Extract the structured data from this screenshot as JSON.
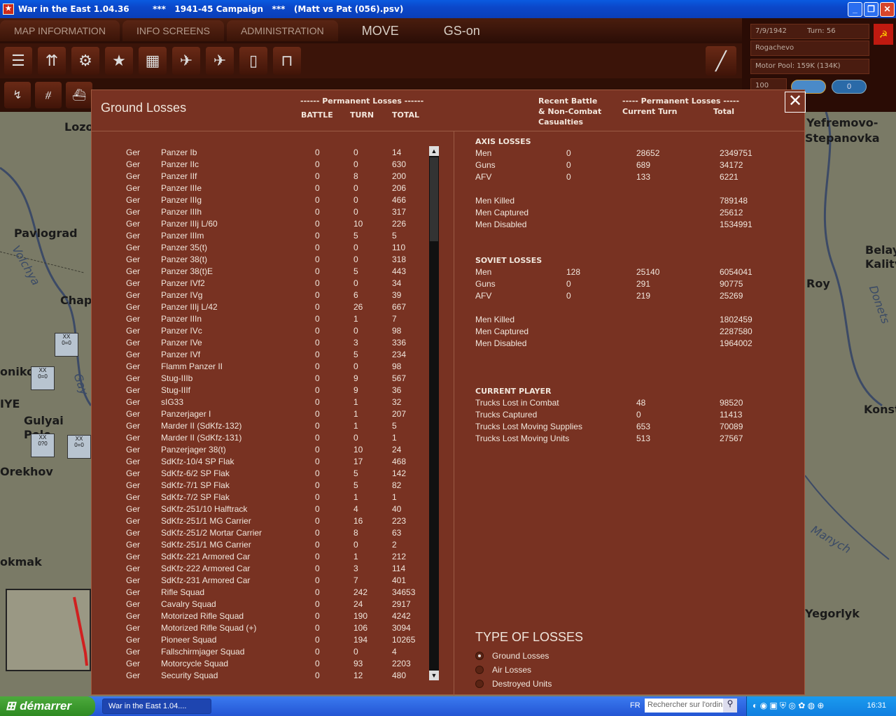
{
  "window": {
    "title": "War in the East 1.04.36        ***   1941-45 Campaign   ***   (Matt vs Pat (056).psv)",
    "buttons": [
      "_",
      "❐",
      "✕"
    ]
  },
  "menu": {
    "tabs": [
      "MAP INFORMATION",
      "INFO SCREENS",
      "ADMINISTRATION"
    ],
    "move": "MOVE",
    "gs": "GS-on"
  },
  "info": {
    "date": "7/9/1942",
    "turn": "Turn: 56",
    "location": "Rogachevo",
    "motor_pool": "Motor Pool: 159K (134K)",
    "zoom": "100",
    "counter": "0"
  },
  "map_labels": {
    "lozo": "Lozo",
    "pavlograd": "Pavlograd",
    "volchya": "Volchya",
    "chap": "Chap",
    "onikolo": "onikolo",
    "iye": "IYE",
    "gulyai": "Gulyai",
    "pole": "Pole",
    "orekhov": "Orekhov",
    "tokmak": "okmak",
    "gay": "Gay",
    "yefremovo": "Yefremovo-",
    "stepanovka": "Stepanovka",
    "belay": "Belay",
    "kalitv": "Kalitv",
    "roy": "Roy",
    "donets": "Donets",
    "konst": "Konst",
    "manych": "Manych",
    "yegorlyk": "Yegorlyk"
  },
  "dialog": {
    "title": "Ground Losses",
    "left_header": {
      "group": "------ Permanent Losses ------",
      "battle": "BATTLE",
      "turn": "TURN",
      "total": "TOTAL"
    },
    "right_header": {
      "recent": "Recent Battle\n& Non-Combat\nCasualties",
      "perm": "----- Permanent Losses -----",
      "current_turn": "Current Turn",
      "total": "Total"
    },
    "rows": [
      [
        "Ger",
        "Panzer Ib",
        "0",
        "0",
        "14"
      ],
      [
        "Ger",
        "Panzer IIc",
        "0",
        "0",
        "630"
      ],
      [
        "Ger",
        "Panzer IIf",
        "0",
        "8",
        "200"
      ],
      [
        "Ger",
        "Panzer IIIe",
        "0",
        "0",
        "206"
      ],
      [
        "Ger",
        "Panzer IIIg",
        "0",
        "0",
        "466"
      ],
      [
        "Ger",
        "Panzer IIIh",
        "0",
        "0",
        "317"
      ],
      [
        "Ger",
        "Panzer IIIj L/60",
        "0",
        "10",
        "226"
      ],
      [
        "Ger",
        "Panzer IIIm",
        "0",
        "5",
        "5"
      ],
      [
        "Ger",
        "Panzer 35(t)",
        "0",
        "0",
        "110"
      ],
      [
        "Ger",
        "Panzer 38(t)",
        "0",
        "0",
        "318"
      ],
      [
        "Ger",
        "Panzer 38(t)E",
        "0",
        "5",
        "443"
      ],
      [
        "Ger",
        "Panzer IVf2",
        "0",
        "0",
        "34"
      ],
      [
        "Ger",
        "Panzer IVg",
        "0",
        "6",
        "39"
      ],
      [
        "Ger",
        "Panzer IIIj L/42",
        "0",
        "26",
        "667"
      ],
      [
        "Ger",
        "Panzer IIIn",
        "0",
        "1",
        "7"
      ],
      [
        "Ger",
        "Panzer IVc",
        "0",
        "0",
        "98"
      ],
      [
        "Ger",
        "Panzer IVe",
        "0",
        "3",
        "336"
      ],
      [
        "Ger",
        "Panzer IVf",
        "0",
        "5",
        "234"
      ],
      [
        "Ger",
        "Flamm Panzer II",
        "0",
        "0",
        "98"
      ],
      [
        "Ger",
        "Stug-IIIb",
        "0",
        "9",
        "567"
      ],
      [
        "Ger",
        "Stug-IIIf",
        "0",
        "9",
        "36"
      ],
      [
        "Ger",
        "sIG33",
        "0",
        "1",
        "32"
      ],
      [
        "Ger",
        "Panzerjager I",
        "0",
        "1",
        "207"
      ],
      [
        "Ger",
        "Marder II (SdKfz-132)",
        "0",
        "1",
        "5"
      ],
      [
        "Ger",
        "Marder II (SdKfz-131)",
        "0",
        "0",
        "1"
      ],
      [
        "Ger",
        "Panzerjager 38(t)",
        "0",
        "10",
        "24"
      ],
      [
        "Ger",
        "SdKfz-10/4 SP Flak",
        "0",
        "17",
        "468"
      ],
      [
        "Ger",
        "SdKfz-6/2 SP Flak",
        "0",
        "5",
        "142"
      ],
      [
        "Ger",
        "SdKfz-7/1 SP Flak",
        "0",
        "5",
        "82"
      ],
      [
        "Ger",
        "SdKfz-7/2 SP Flak",
        "0",
        "1",
        "1"
      ],
      [
        "Ger",
        "SdKfz-251/10 Halftrack",
        "0",
        "4",
        "40"
      ],
      [
        "Ger",
        "SdKfz-251/1 MG Carrier",
        "0",
        "16",
        "223"
      ],
      [
        "Ger",
        "SdKfz-251/2 Mortar Carrier",
        "0",
        "8",
        "63"
      ],
      [
        "Ger",
        "SdKfz-251/1 MG Carrier",
        "0",
        "0",
        "2"
      ],
      [
        "Ger",
        "SdKfz-221 Armored Car",
        "0",
        "1",
        "212"
      ],
      [
        "Ger",
        "SdKfz-222 Armored Car",
        "0",
        "3",
        "114"
      ],
      [
        "Ger",
        "SdKfz-231 Armored Car",
        "0",
        "7",
        "401"
      ],
      [
        "Ger",
        "Rifle Squad",
        "0",
        "242",
        "34653"
      ],
      [
        "Ger",
        "Cavalry Squad",
        "0",
        "24",
        "2917"
      ],
      [
        "Ger",
        "Motorized Rifle Squad",
        "0",
        "190",
        "4242"
      ],
      [
        "Ger",
        "Motorized Rifle Squad (+)",
        "0",
        "106",
        "3094"
      ],
      [
        "Ger",
        "Pioneer Squad",
        "0",
        "194",
        "10265"
      ],
      [
        "Ger",
        "Fallschirmjager Squad",
        "0",
        "0",
        "4"
      ],
      [
        "Ger",
        "Motorcycle Squad",
        "0",
        "93",
        "2203"
      ],
      [
        "Ger",
        "Security Squad",
        "0",
        "12",
        "480"
      ]
    ],
    "axis": {
      "title": "AXIS LOSSES",
      "rows": [
        [
          "Men",
          "0",
          "28652",
          "2349751"
        ],
        [
          "Guns",
          "0",
          "689",
          "34172"
        ],
        [
          "AFV",
          "0",
          "133",
          "6221"
        ]
      ],
      "casualties": [
        [
          "Men Killed",
          "789148"
        ],
        [
          "Men Captured",
          "25612"
        ],
        [
          "Men Disabled",
          "1534991"
        ]
      ]
    },
    "soviet": {
      "title": "SOVIET LOSSES",
      "rows": [
        [
          "Men",
          "128",
          "25140",
          "6054041"
        ],
        [
          "Guns",
          "0",
          "291",
          "90775"
        ],
        [
          "AFV",
          "0",
          "219",
          "25269"
        ]
      ],
      "casualties": [
        [
          "Men Killed",
          "1802459"
        ],
        [
          "Men Captured",
          "2287580"
        ],
        [
          "Men Disabled",
          "1964002"
        ]
      ]
    },
    "player": {
      "title": "CURRENT PLAYER",
      "rows": [
        [
          "Trucks Lost in Combat",
          "48",
          "98520"
        ],
        [
          "Trucks Captured",
          "0",
          "11413"
        ],
        [
          "Trucks Lost Moving Supplies",
          "653",
          "70089"
        ],
        [
          "Trucks Lost Moving Units",
          "513",
          "27567"
        ]
      ]
    },
    "type_title": "TYPE OF LOSSES",
    "types": [
      "Ground Losses",
      "Air Losses",
      "Destroyed Units"
    ],
    "selected_type": "Ground Losses"
  },
  "taskbar": {
    "start": "démarrer",
    "task": "War in the East 1.04....",
    "lang": "FR",
    "search_placeholder": "Rechercher sur l'ordin",
    "clock": "16:31"
  }
}
